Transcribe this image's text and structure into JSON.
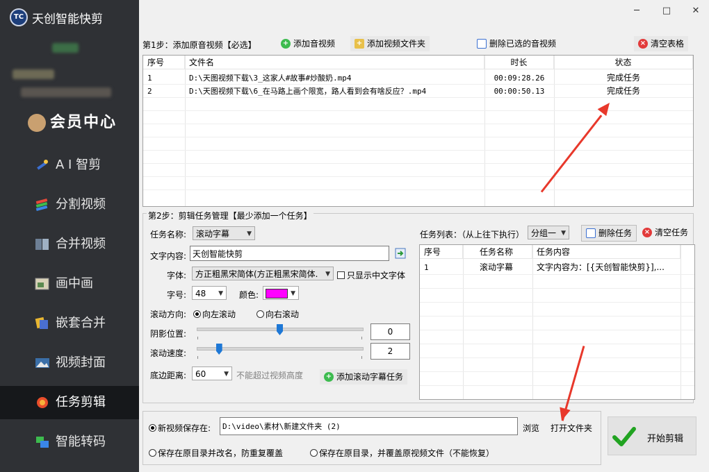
{
  "app": {
    "title": "天创智能快剪",
    "logo_text": "TC"
  },
  "sidebar": {
    "member_label": "会员中心",
    "items": [
      {
        "label": "A I 智剪",
        "icon": "ai-wand-icon"
      },
      {
        "label": "分割视频",
        "icon": "split-video-icon"
      },
      {
        "label": "合并视频",
        "icon": "merge-video-icon"
      },
      {
        "label": "画中画",
        "icon": "picture-in-picture-icon"
      },
      {
        "label": "嵌套合并",
        "icon": "nest-merge-icon"
      },
      {
        "label": "视频封面",
        "icon": "video-cover-icon"
      },
      {
        "label": "任务剪辑",
        "icon": "task-edit-icon",
        "active": true
      },
      {
        "label": "智能转码",
        "icon": "transcode-icon"
      }
    ]
  },
  "window": {
    "minimize": "─",
    "maximize": "□",
    "close": "✕"
  },
  "step1": {
    "label": "第1步：添加原音视频【必选】",
    "add_video": "添加音视频",
    "add_folder": "添加视频文件夹",
    "delete_selected": "删除已选的音视频",
    "clear_table": "清空表格",
    "columns": [
      "序号",
      "文件名",
      "时长",
      "状态"
    ],
    "rows": [
      {
        "no": "1",
        "file": "D:\\天图视频下载\\3_这家人#故事#炒酸奶.mp4",
        "duration": "00:09:28.26",
        "status": "完成任务"
      },
      {
        "no": "2",
        "file": "D:\\天图视频下载\\6_在马路上画个限宽，路人看到会有啥反应？.mp4",
        "duration": "00:00:50.13",
        "status": "完成任务"
      }
    ]
  },
  "step2": {
    "label": "第2步：剪辑任务管理【最少添加一个任务】",
    "task_name_label": "任务名称:",
    "task_name_value": "滚动字幕",
    "text_content_label": "文字内容:",
    "text_content_value": "天创智能快剪",
    "font_label": "字体:",
    "font_value": "方正粗黑宋简体(方正粗黑宋简体.",
    "chinese_only_label": "只显示中文字体",
    "size_label": "字号:",
    "size_value": "48",
    "color_label": "颜色:",
    "color_value": "#ff00ff",
    "direction_label": "滚动方向:",
    "dir_left": "向左滚动",
    "dir_right": "向右滚动",
    "shadow_label": "阴影位置:",
    "shadow_value": "0",
    "shadow_level": 0.5,
    "speed_label": "滚动速度:",
    "speed_value": "2",
    "speed_level": 0.13,
    "bottom_label": "底边距离:",
    "bottom_value": "60",
    "bottom_hint": "不能超过视频高度",
    "add_task": "添加滚动字幕任务",
    "task_list_label": "任务列表：（从上往下执行）",
    "group_value": "分组一",
    "delete_task": "删除任务",
    "clear_task": "清空任务",
    "task_columns": [
      "序号",
      "任务名称",
      "任务内容"
    ],
    "tasks": [
      {
        "no": "1",
        "name": "滚动字幕",
        "content": "文字内容为：[{天创智能快剪}],..."
      }
    ]
  },
  "output": {
    "save_new_label": "新视频保存在:",
    "path_value": "D:\\video\\素材\\新建文件夹 (2)",
    "browse": "浏览",
    "open_folder": "打开文件夹",
    "save_rename": "保存在原目录并改名，防重复覆盖",
    "save_overwrite": "保存在原目录，并覆盖原视频文件（不能恢复）",
    "start": "开始剪辑"
  },
  "colors": {
    "sidebar_bg": "#2f3135",
    "active_bg": "#16181b",
    "accent_red": "#e8382b",
    "check_green": "#21a321"
  }
}
